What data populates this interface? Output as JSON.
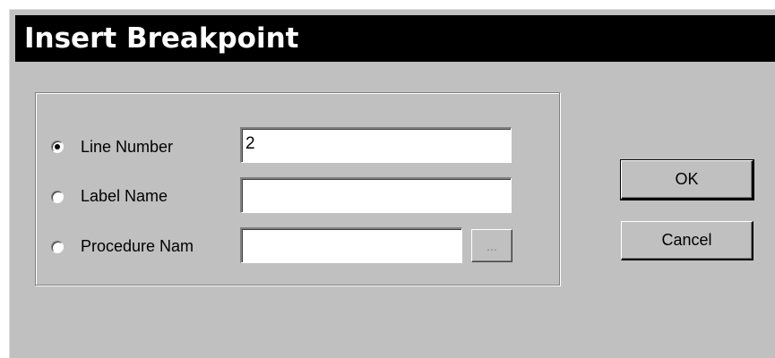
{
  "dialog": {
    "title": "Insert Breakpoint"
  },
  "options": [
    {
      "label": "Line Number",
      "selected": true,
      "value": "2"
    },
    {
      "label": "Label Name",
      "selected": false,
      "value": ""
    },
    {
      "label": "Procedure Nam",
      "selected": false,
      "value": ""
    }
  ],
  "browse_button": {
    "label": "...",
    "enabled": false
  },
  "buttons": {
    "ok_label": "OK",
    "cancel_label": "Cancel"
  },
  "colors": {
    "face": "#c0c0c0",
    "titlebar": "#000000",
    "title_text": "#ffffff"
  }
}
